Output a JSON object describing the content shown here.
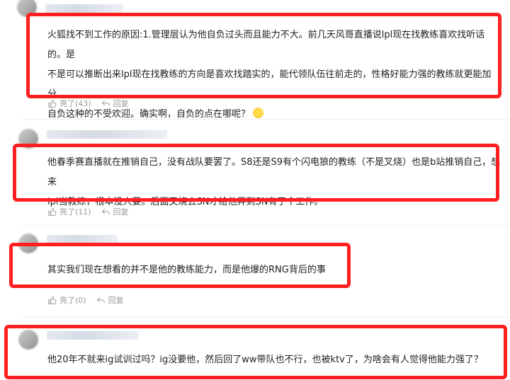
{
  "comments": [
    {
      "lines": [
        "火狐找不到工作的原因:1.管理层认为他自负过头而且能力不大。前几天风哥直播说lpl现在找教练喜欢找听话的。是",
        "不是可以推断出来lpl现在找教练的方向是喜欢找踏实的，能代领队伍往前走的，性格好能力强的教练就更能加分，",
        "自负这种的不受欢迎。确实啊，自负的点在哪呢？"
      ],
      "emoji": "laughing-emoji",
      "like_label": "亮了(43)",
      "reply_label": "回复"
    },
    {
      "lines": [
        "他春季赛直播就在推销自己，没有战队要罢了。S8还是S9有个闪电狼的教练（不是叉烧）也是b站推销自己，想来",
        "lpl当教练，根本没人要。后面叉烧去SN才给他弄到SN有了个工作。"
      ],
      "like_label": "亮了(11)",
      "reply_label": "回复"
    },
    {
      "lines": [
        "其实我们现在想看的并不是他的教练能力，而是他爆的RNG背后的事"
      ],
      "like_label": "亮了(0)",
      "reply_label": "回复"
    },
    {
      "lines": [
        "他20年不就来ig试训过吗？ig没要他，然后回了ww带队也不行，也被ktv了，为啥会有人觉得他能力强了？"
      ]
    }
  ],
  "colors": {
    "highlight": "#ff1f1f",
    "action_text": "#9a9a9a"
  },
  "icons": {
    "like": "thumbs-up-icon",
    "reply": "reply-arrow-icon"
  }
}
